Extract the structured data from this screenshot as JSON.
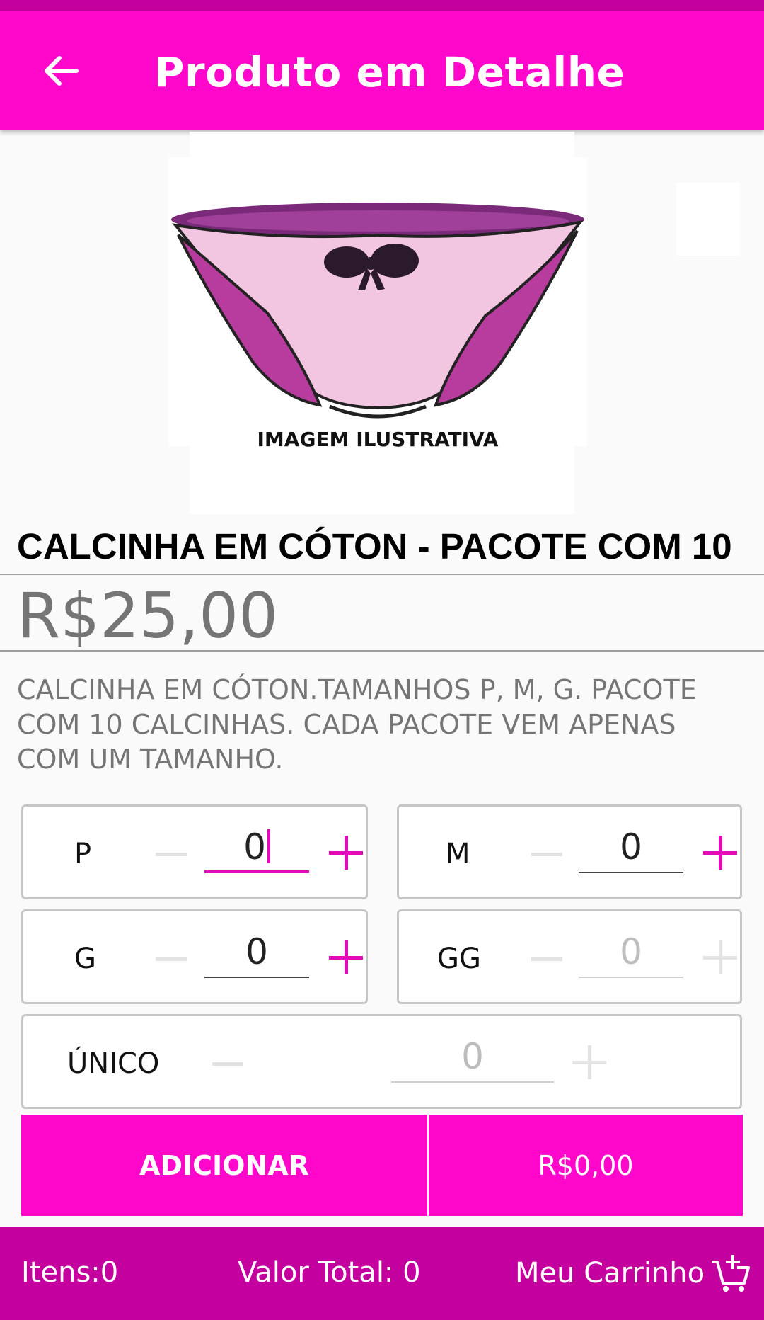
{
  "header": {
    "title": "Produto em Detalhe"
  },
  "image": {
    "caption": "IMAGEM ILUSTRATIVA"
  },
  "product": {
    "title": "CALCINHA EM CÓTON - PACOTE COM 10",
    "price": "R$25,00",
    "description": "CALCINHA EM CÓTON.TAMANHOS P, M, G. PACOTE COM 10 CALCINHAS. CADA PACOTE VEM APENAS COM UM TAMANHO."
  },
  "sizes": [
    {
      "label": "P",
      "qty": "0"
    },
    {
      "label": "M",
      "qty": "0"
    },
    {
      "label": "G",
      "qty": "0"
    },
    {
      "label": "GG",
      "qty": "0"
    },
    {
      "label": "ÚNICO",
      "qty": "0"
    }
  ],
  "actions": {
    "add_label": "ADICIONAR",
    "subtotal": "R$0,00"
  },
  "footer": {
    "items": "Itens:0",
    "total": "Valor Total: 0",
    "cart_label": "Meu Carrinho"
  },
  "colors": {
    "primary": "#ff08cc",
    "primary_dark": "#c4009e",
    "accent": "#e30ab8"
  }
}
